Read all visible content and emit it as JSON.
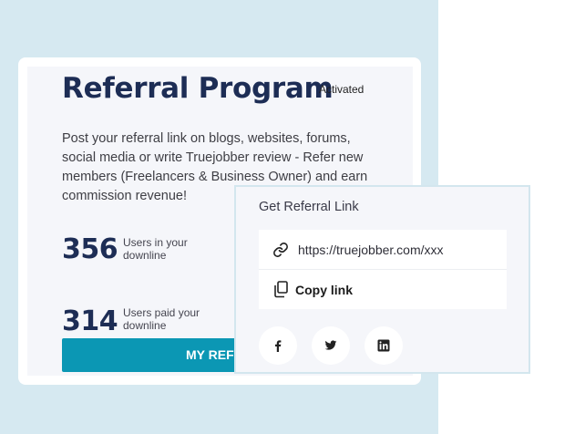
{
  "program": {
    "title": "Referral Program",
    "status": "Activated",
    "description": "Post your referral link on blogs, websites, forums, social media or write Truejobber review - Refer new members (Freelancers & Business Owner) and earn commission revenue!",
    "stats": [
      {
        "value": "356",
        "label": "Users in your downline"
      },
      {
        "value": "314",
        "label": "Users paid your downline"
      }
    ],
    "cta_label": "MY REFERRALS"
  },
  "popup": {
    "title": "Get Referral Link",
    "url": "https://truejobber.com/xxx",
    "copy_label": "Copy link",
    "social": [
      {
        "name": "facebook",
        "icon": "facebook-icon"
      },
      {
        "name": "twitter",
        "icon": "twitter-icon"
      },
      {
        "name": "linkedin",
        "icon": "linkedin-icon"
      }
    ]
  },
  "colors": {
    "background": "#d6e9f1",
    "heading": "#1d2d55",
    "button": "#0b97b4",
    "panel": "#f5f6fa"
  }
}
